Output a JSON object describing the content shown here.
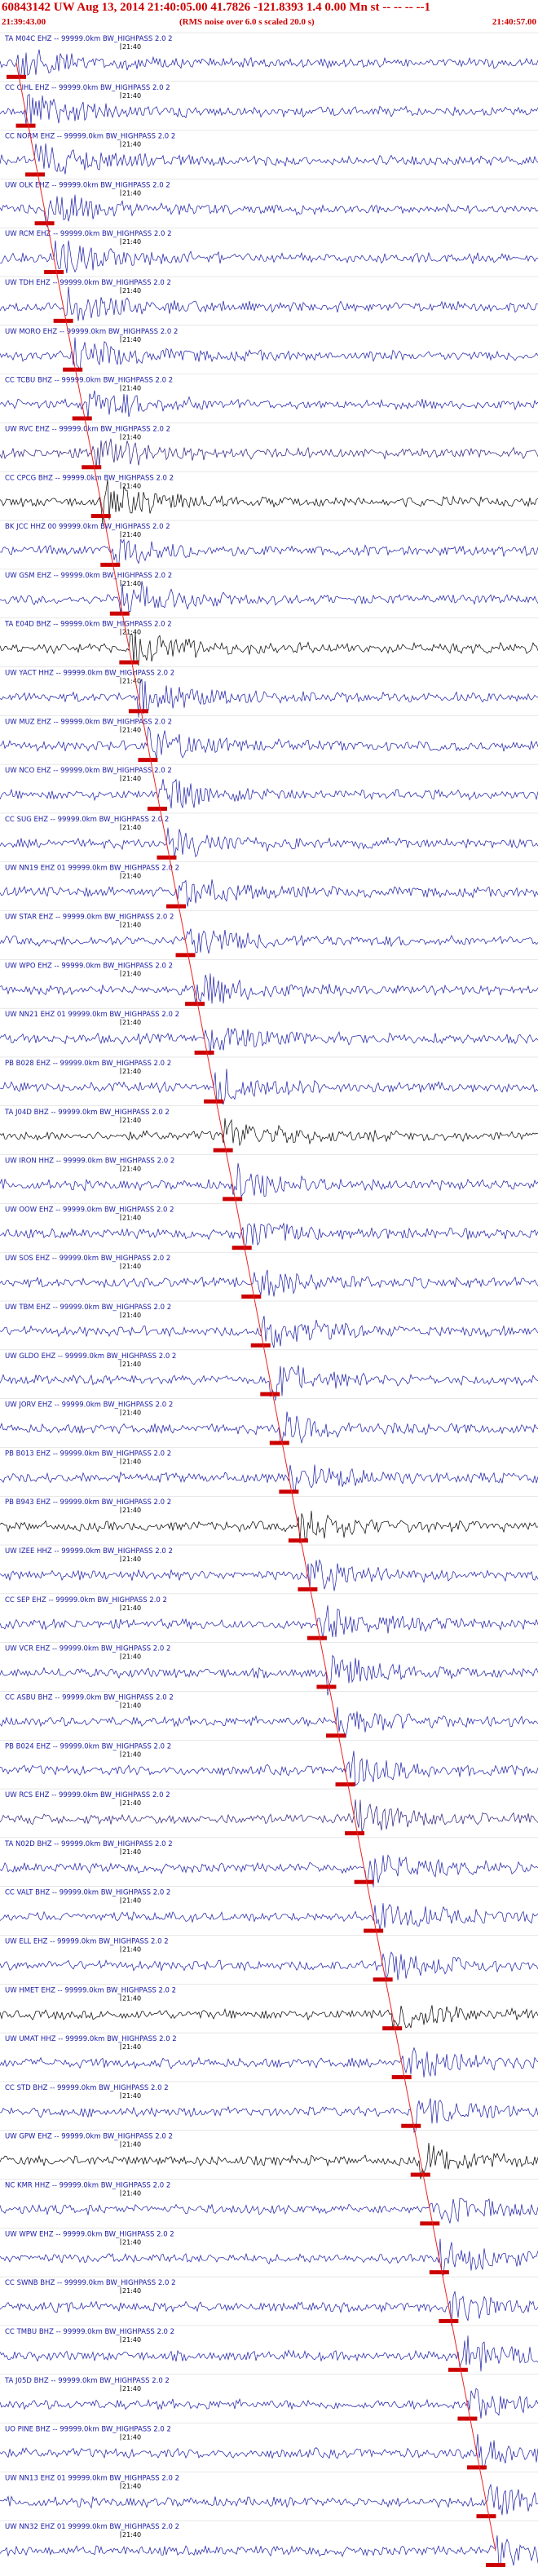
{
  "header": {
    "title": "60843142 UW Aug 13, 2014 21:40:05.00   41.7826 -121.8393  1.4 0.00 Mn st -- -- -- --1",
    "start_time": "21:39:43.00",
    "note": "(RMS noise over 6.0 s scaled 20.0 s)",
    "end_time": "21:40:57.00"
  },
  "chart_data": {
    "type": "seismogram",
    "time_start": "21:39:43.00",
    "time_end": "21:40:57.00",
    "time_tick_label": "21:40",
    "trace_count": 49,
    "traces": [
      {
        "label": "TA M04C EHZ -- 99999.0km BW_HIGHPASS  2.0  2",
        "color": "#1a1aa6"
      },
      {
        "label": "CC CIHL EHZ -- 99999.0km BW_HIGHPASS  2.0  2",
        "color": "#1a1aa6"
      },
      {
        "label": "CC NORM EHZ -- 99999.0km BW_HIGHPASS  2.0  2",
        "color": "#1a1aa6"
      },
      {
        "label": "UW OLK EHZ -- 99999.0km BW_HIGHPASS  2.0  2",
        "color": "#1a1aa6"
      },
      {
        "label": "UW RCM EHZ -- 99999.0km BW_HIGHPASS  2.0  2",
        "color": "#1a1aa6"
      },
      {
        "label": "UW TDH EHZ -- 99999.0km BW_HIGHPASS  2.0  2",
        "color": "#1a1aa6"
      },
      {
        "label": "UW MORO EHZ -- 99999.0km BW_HIGHPASS  2.0  2",
        "color": "#1a1aa6"
      },
      {
        "label": "CC TCBU BHZ -- 99999.0km BW_HIGHPASS  2.0  2",
        "color": "#1a1aa6"
      },
      {
        "label": "UW RVC EHZ -- 99999.0km BW_HIGHPASS  2.0  2",
        "color": "#2a1a7a"
      },
      {
        "label": "CC CPCG BHZ -- 99999.0km BW_HIGHPASS  2.0  2",
        "color": "#000000"
      },
      {
        "label": "BK JCC HHZ 00 99999.0km BW_HIGHPASS  2.0  2",
        "color": "#1a1aa6"
      },
      {
        "label": "UW GSM EHZ -- 99999.0km BW_HIGHPASS  2.0  2",
        "color": "#1a1aa6"
      },
      {
        "label": "TA E04D BHZ -- 99999.0km BW_HIGHPASS  2.0  2",
        "color": "#000000"
      },
      {
        "label": "UW YACT HHZ -- 99999.0km BW_HIGHPASS  2.0  2",
        "color": "#1a1aa6"
      },
      {
        "label": "UW MUZ EHZ -- 99999.0km BW_HIGHPASS  2.0  2",
        "color": "#1a1aa6"
      },
      {
        "label": "UW NCO EHZ -- 99999.0km BW_HIGHPASS  2.0  2",
        "color": "#1a1aa6"
      },
      {
        "label": "CC SUG EHZ -- 99999.0km BW_HIGHPASS  2.0  2",
        "color": "#1a1aa6"
      },
      {
        "label": "UW NN19 EHZ 01 99999.0km BW_HIGHPASS  2.0  2",
        "color": "#1a1aa6"
      },
      {
        "label": "UW STAR EHZ -- 99999.0km BW_HIGHPASS  2.0  2",
        "color": "#1a1aa6"
      },
      {
        "label": "UW WPO EHZ -- 99999.0km BW_HIGHPASS  2.0  2",
        "color": "#1a1aa6"
      },
      {
        "label": "UW NN21 EHZ 01 99999.0km BW_HIGHPASS  2.0  2",
        "color": "#1a1aa6"
      },
      {
        "label": "PB B028 EHZ -- 99999.0km BW_HIGHPASS  2.0  2",
        "color": "#1a1aa6"
      },
      {
        "label": "TA J04D BHZ -- 99999.0km BW_HIGHPASS  2.0  2",
        "color": "#000000"
      },
      {
        "label": "UW IRON HHZ -- 99999.0km BW_HIGHPASS  2.0  2",
        "color": "#1a1aa6"
      },
      {
        "label": "UW OOW EHZ -- 99999.0km BW_HIGHPASS  2.0  2",
        "color": "#1a1aa6"
      },
      {
        "label": "UW SOS EHZ -- 99999.0km BW_HIGHPASS  2.0  2",
        "color": "#1a1aa6"
      },
      {
        "label": "UW TBM EHZ -- 99999.0km BW_HIGHPASS  2.0  2",
        "color": "#1a1aa6"
      },
      {
        "label": "UW GLDO EHZ -- 99999.0km BW_HIGHPASS  2.0  2",
        "color": "#1a1aa6"
      },
      {
        "label": "UW JORV EHZ -- 99999.0km BW_HIGHPASS  2.0  2",
        "color": "#1a1aa6"
      },
      {
        "label": "PB B013 EHZ -- 99999.0km BW_HIGHPASS  2.0  2",
        "color": "#1a1aa6"
      },
      {
        "label": "PB B943 EHZ -- 99999.0km BW_HIGHPASS  2.0  2",
        "color": "#000000"
      },
      {
        "label": "UW IZEE HHZ -- 99999.0km BW_HIGHPASS  2.0  2",
        "color": "#1a1aa6"
      },
      {
        "label": "CC SEP EHZ -- 99999.0km BW_HIGHPASS  2.0  2",
        "color": "#1a1aa6"
      },
      {
        "label": "UW VCR EHZ -- 99999.0km BW_HIGHPASS  2.0  2",
        "color": "#1a1aa6"
      },
      {
        "label": "CC ASBU BHZ -- 99999.0km BW_HIGHPASS  2.0  2",
        "color": "#1a1aa6"
      },
      {
        "label": "PB B024 EHZ -- 99999.0km BW_HIGHPASS  2.0  2",
        "color": "#1a1aa6"
      },
      {
        "label": "UW RCS EHZ -- 99999.0km BW_HIGHPASS  2.0  2",
        "color": "#2a1a7a"
      },
      {
        "label": "TA N02D BHZ -- 99999.0km BW_HIGHPASS  2.0  2",
        "color": "#1a1aa6"
      },
      {
        "label": "CC VALT BHZ -- 99999.0km BW_HIGHPASS  2.0  2",
        "color": "#1a1aa6"
      },
      {
        "label": "UW ELL EHZ -- 99999.0km BW_HIGHPASS  2.0  2",
        "color": "#1a1aa6"
      },
      {
        "label": "UW HMET EHZ -- 99999.0km BW_HIGHPASS  2.0  2",
        "color": "#000000"
      },
      {
        "label": "UW UMAT HHZ -- 99999.0km BW_HIGHPASS  2.0  2",
        "color": "#1a1aa6"
      },
      {
        "label": "CC STD BHZ -- 99999.0km BW_HIGHPASS  2.0  2",
        "color": "#1a1aa6"
      },
      {
        "label": "UW GPW EHZ -- 99999.0km BW_HIGHPASS  2.0  2",
        "color": "#000000"
      },
      {
        "label": "NC KMR HHZ -- 99999.0km BW_HIGHPASS  2.0  2",
        "color": "#1a1aa6"
      },
      {
        "label": "UW WPW EHZ -- 99999.0km BW_HIGHPASS  2.0  2",
        "color": "#1a1aa6"
      },
      {
        "label": "CC SWNB BHZ -- 99999.0km BW_HIGHPASS  2.0  2",
        "color": "#1a1aa6"
      },
      {
        "label": "CC TMBU BHZ -- 99999.0km BW_HIGHPASS  2.0  2",
        "color": "#1a1aa6"
      },
      {
        "label": "TA J05D BHZ -- 99999.0km BW_HIGHPASS  2.0  2",
        "color": "#1a1aa6"
      },
      {
        "label": "UO PINE BHZ -- 99999.0km BW_HIGHPASS  2.0  2",
        "color": "#1a1aa6"
      },
      {
        "label": "UW NN13 EHZ 01 99999.0km BW_HIGHPASS  2.0  2",
        "color": "#1a1aa6"
      },
      {
        "label": "UW NN32 EHZ 01 99999.0km BW_HIGHPASS  2.0  2",
        "color": "#1a1aa6"
      }
    ],
    "colors": {
      "header_text": "#cc0000",
      "pick_marker": "#cc0000",
      "moveout_line": "#ee2222",
      "label_text": "#1a1aa6"
    }
  }
}
